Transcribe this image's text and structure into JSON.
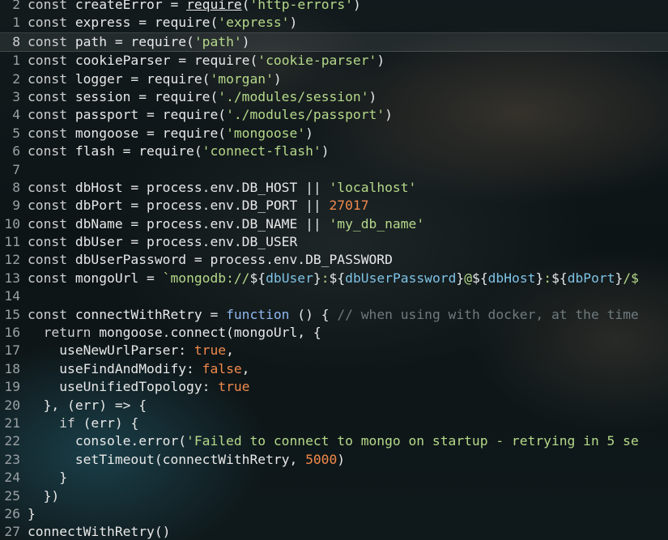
{
  "editor": {
    "lines": [
      {
        "num": "2",
        "parts": [
          [
            "k",
            "const"
          ],
          [
            "p",
            " createError = "
          ],
          [
            "u",
            "require"
          ],
          [
            "p",
            "("
          ],
          [
            "str",
            "'http-errors'"
          ],
          [
            "p",
            ")"
          ]
        ]
      },
      {
        "num": "1",
        "parts": [
          [
            "k",
            "const"
          ],
          [
            "p",
            " express = require("
          ],
          [
            "str",
            "'express'"
          ],
          [
            "p",
            ")"
          ]
        ]
      },
      {
        "num": "8",
        "current": true,
        "parts": [
          [
            "k",
            "const"
          ],
          [
            "p",
            " path = require("
          ],
          [
            "str",
            "'path'"
          ],
          [
            "p",
            ")"
          ]
        ]
      },
      {
        "num": "1",
        "parts": [
          [
            "k",
            "const"
          ],
          [
            "p",
            " cookieParser = require("
          ],
          [
            "str",
            "'cookie-parser'"
          ],
          [
            "p",
            ")"
          ]
        ]
      },
      {
        "num": "2",
        "parts": [
          [
            "k",
            "const"
          ],
          [
            "p",
            " logger = require("
          ],
          [
            "str",
            "'morgan'"
          ],
          [
            "p",
            ")"
          ]
        ]
      },
      {
        "num": "3",
        "parts": [
          [
            "k",
            "const"
          ],
          [
            "p",
            " session = require("
          ],
          [
            "str",
            "'./modules/session'"
          ],
          [
            "p",
            ")"
          ]
        ]
      },
      {
        "num": "4",
        "parts": [
          [
            "k",
            "const"
          ],
          [
            "p",
            " passport = require("
          ],
          [
            "str",
            "'./modules/passport'"
          ],
          [
            "p",
            ")"
          ]
        ]
      },
      {
        "num": "5",
        "parts": [
          [
            "k",
            "const"
          ],
          [
            "p",
            " mongoose = require("
          ],
          [
            "str",
            "'mongoose'"
          ],
          [
            "p",
            ")"
          ]
        ]
      },
      {
        "num": "6",
        "parts": [
          [
            "k",
            "const"
          ],
          [
            "p",
            " flash = require("
          ],
          [
            "str",
            "'connect-flash'"
          ],
          [
            "p",
            ")"
          ]
        ]
      },
      {
        "num": "7",
        "parts": []
      },
      {
        "num": "8",
        "parts": [
          [
            "k",
            "const"
          ],
          [
            "p",
            " dbHost = process.env.DB_HOST || "
          ],
          [
            "str",
            "'localhost'"
          ]
        ]
      },
      {
        "num": "9",
        "parts": [
          [
            "k",
            "const"
          ],
          [
            "p",
            " dbPort = process.env.DB_PORT || "
          ],
          [
            "num",
            "27017"
          ]
        ]
      },
      {
        "num": "10",
        "parts": [
          [
            "k",
            "const"
          ],
          [
            "p",
            " dbName = process.env.DB_NAME || "
          ],
          [
            "str",
            "'my_db_name'"
          ]
        ]
      },
      {
        "num": "11",
        "parts": [
          [
            "k",
            "const"
          ],
          [
            "p",
            " dbUser = process.env.DB_USER"
          ]
        ]
      },
      {
        "num": "12",
        "parts": [
          [
            "k",
            "const"
          ],
          [
            "p",
            " dbUserPassword = process.env.DB_PASSWORD"
          ]
        ]
      },
      {
        "num": "13",
        "parts": [
          [
            "k",
            "const"
          ],
          [
            "p",
            " mongoUrl = "
          ],
          [
            "tpl",
            "`mongodb://"
          ],
          [
            "p",
            "${"
          ],
          [
            "var",
            "dbUser"
          ],
          [
            "p",
            "}"
          ],
          [
            "tpl",
            ":"
          ],
          [
            "p",
            "${"
          ],
          [
            "var",
            "dbUserPassword"
          ],
          [
            "p",
            "}"
          ],
          [
            "tpl",
            "@"
          ],
          [
            "p",
            "${"
          ],
          [
            "var",
            "dbHost"
          ],
          [
            "p",
            "}"
          ],
          [
            "tpl",
            ":"
          ],
          [
            "p",
            "${"
          ],
          [
            "var",
            "dbPort"
          ],
          [
            "p",
            "}"
          ],
          [
            "tpl",
            "/$"
          ]
        ]
      },
      {
        "num": "14",
        "parts": []
      },
      {
        "num": "15",
        "parts": [
          [
            "k",
            "const"
          ],
          [
            "p",
            " connectWithRetry = "
          ],
          [
            "fn",
            "function"
          ],
          [
            "p",
            " () { "
          ],
          [
            "cm",
            "// when using with docker, at the time"
          ]
        ]
      },
      {
        "num": "16",
        "parts": [
          [
            "k",
            "  return"
          ],
          [
            "p",
            " mongoose.connect(mongoUrl, {"
          ]
        ]
      },
      {
        "num": "17",
        "parts": [
          [
            "p",
            "    useNewUrlParser: "
          ],
          [
            "bool",
            "true"
          ],
          [
            "p",
            ","
          ]
        ]
      },
      {
        "num": "18",
        "parts": [
          [
            "p",
            "    useFindAndModify: "
          ],
          [
            "bool",
            "false"
          ],
          [
            "p",
            ","
          ]
        ]
      },
      {
        "num": "19",
        "parts": [
          [
            "p",
            "    useUnifiedTopology: "
          ],
          [
            "bool",
            "true"
          ]
        ]
      },
      {
        "num": "20",
        "parts": [
          [
            "p",
            "  }, (err) => {"
          ]
        ]
      },
      {
        "num": "21",
        "parts": [
          [
            "k",
            "    if"
          ],
          [
            "p",
            " (err) {"
          ]
        ]
      },
      {
        "num": "22",
        "parts": [
          [
            "p",
            "      console.error("
          ],
          [
            "str",
            "'Failed to connect to mongo on startup - retrying in 5 se"
          ]
        ]
      },
      {
        "num": "23",
        "parts": [
          [
            "p",
            "      setTimeout(connectWithRetry, "
          ],
          [
            "num",
            "5000"
          ],
          [
            "p",
            ")"
          ]
        ]
      },
      {
        "num": "24",
        "parts": [
          [
            "p",
            "    }"
          ]
        ]
      },
      {
        "num": "25",
        "parts": [
          [
            "p",
            "  })"
          ]
        ]
      },
      {
        "num": "26",
        "parts": [
          [
            "p",
            "}"
          ]
        ]
      },
      {
        "num": "27",
        "parts": [
          [
            "p",
            "connectWithRetry()"
          ]
        ]
      }
    ]
  }
}
